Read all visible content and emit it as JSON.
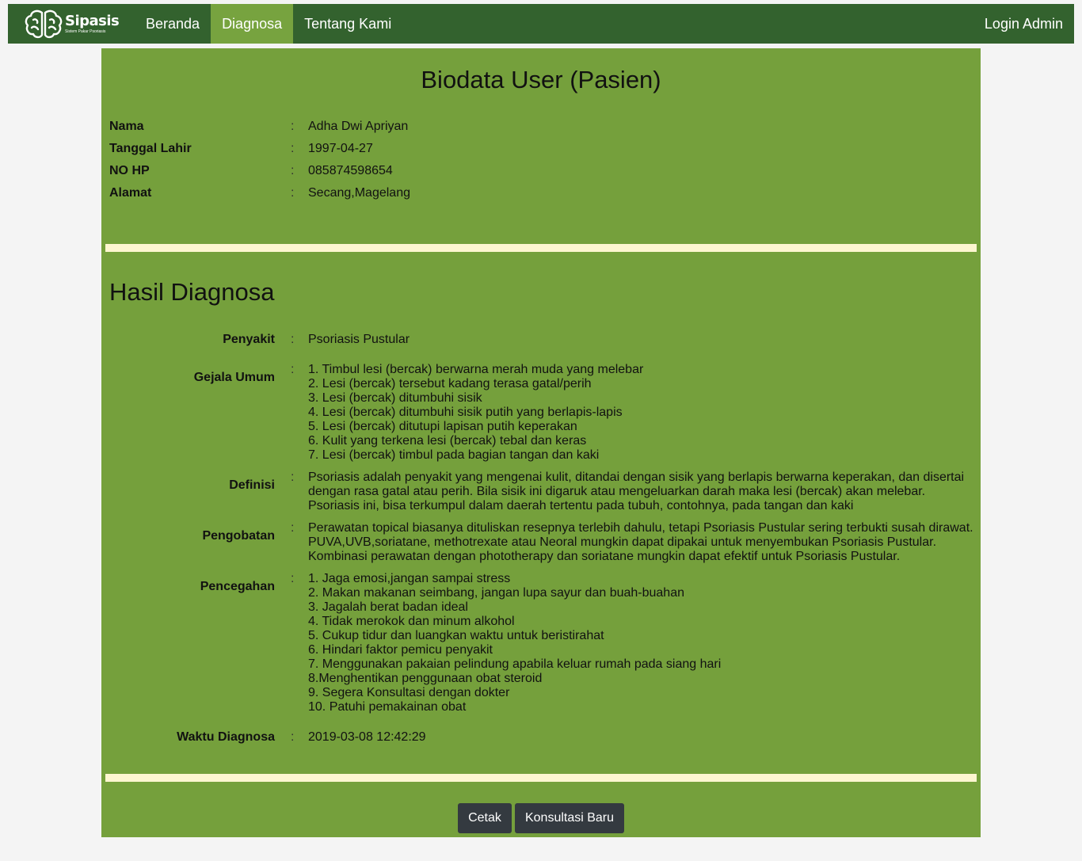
{
  "navbar": {
    "brand_name": "Sipasis",
    "brand_subtitle": "Sistem Pakar Psoriasis",
    "items": [
      {
        "label": "Beranda"
      },
      {
        "label": "Diagnosa"
      },
      {
        "label": "Tentang Kami"
      }
    ],
    "login_label": "Login Admin"
  },
  "biodata": {
    "title": "Biodata User (Pasien)",
    "fields": [
      {
        "label": "Nama",
        "value": "Adha Dwi Apriyan"
      },
      {
        "label": "Tanggal Lahir",
        "value": "1997-04-27"
      },
      {
        "label": "NO HP",
        "value": "085874598654"
      },
      {
        "label": "Alamat",
        "value": "Secang,Magelang"
      }
    ]
  },
  "hasil": {
    "title": "Hasil Diagnosa",
    "penyakit": {
      "label": "Penyakit",
      "value": "Psoriasis Pustular"
    },
    "gejala": {
      "label": "Gejala Umum",
      "items": [
        "1. Timbul lesi (bercak) berwarna merah muda yang melebar",
        "2. Lesi (bercak) tersebut kadang terasa gatal/perih",
        "3. Lesi (bercak) ditumbuhi sisik",
        "4. Lesi (bercak) ditumbuhi sisik putih yang berlapis-lapis",
        "5. Lesi (bercak) ditutupi lapisan putih keperakan",
        "6. Kulit yang terkena lesi (bercak) tebal dan keras",
        "7. Lesi (bercak) timbul pada bagian tangan dan kaki"
      ]
    },
    "definisi": {
      "label": "Definisi",
      "lines": [
        "Psoriasis adalah penyakit yang mengenai kulit, ditandai dengan sisik yang berlapis berwarna keperakan, dan disertai",
        "dengan rasa gatal atau perih. Bila sisik ini digaruk atau mengeluarkan darah maka lesi (bercak) akan melebar.",
        "Psoriasis ini, bisa terkumpul dalam daerah tertentu pada tubuh, contohnya, pada tangan dan kaki"
      ]
    },
    "pengobatan": {
      "label": "Pengobatan",
      "lines": [
        "Perawatan topical biasanya dituliskan resepnya terlebih dahulu, tetapi Psoriasis Pustular sering terbukti susah dirawat.",
        "PUVA,UVB,soriatane, methotrexate atau Neoral mungkin dapat dipakai untuk menyembukan Psoriasis Pustular.",
        "Kombinasi perawatan dengan phototherapy dan soriatane mungkin dapat efektif untuk Psoriasis Pustular."
      ]
    },
    "pencegahan": {
      "label": "Pencegahan",
      "items": [
        "1. Jaga emosi,jangan sampai stress",
        "2. Makan makanan seimbang, jangan lupa sayur dan buah-buahan",
        "3. Jagalah berat badan ideal",
        "4. Tidak merokok dan minum alkohol",
        "5. Cukup tidur dan luangkan waktu untuk beristirahat",
        "6. Hindari faktor pemicu penyakit",
        "7. Menggunakan pakaian pelindung apabila keluar rumah pada siang hari",
        "8.Menghentikan penggunaan obat steroid",
        "9. Segera Konsultasi dengan dokter",
        "10. Patuhi pemakainan obat"
      ]
    },
    "waktu": {
      "label": "Waktu Diagnosa",
      "value": "2019-03-08 12:42:29"
    }
  },
  "colon": ":",
  "buttons": {
    "cetak": "Cetak",
    "konsultasi": "Konsultasi Baru"
  },
  "colors": {
    "navbar": "#33622e",
    "nav_active": "#77a33f",
    "panel": "#75a03c",
    "separator": "#fdf6d0",
    "button": "#343a40"
  }
}
